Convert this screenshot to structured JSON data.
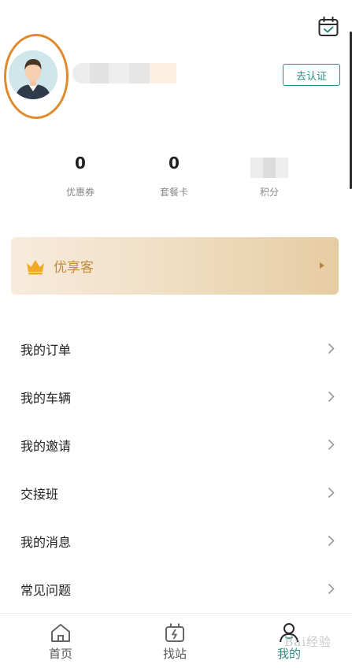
{
  "header": {
    "calendar_icon": "calendar-check-icon"
  },
  "profile": {
    "verify_label": "去认证"
  },
  "stats": {
    "coupons": {
      "value": "0",
      "label": "优惠券"
    },
    "packages": {
      "value": "0",
      "label": "套餐卡"
    },
    "points": {
      "label": "积分"
    }
  },
  "vip": {
    "title": "优享客"
  },
  "menu": {
    "items": [
      {
        "label": "我的订单"
      },
      {
        "label": "我的车辆"
      },
      {
        "label": "我的邀请"
      },
      {
        "label": "交接班"
      },
      {
        "label": "我的消息"
      },
      {
        "label": "常见问题"
      }
    ]
  },
  "tabbar": {
    "home_label": "首页",
    "station_label": "找站",
    "mine_label": "我的"
  },
  "watermark": {
    "text": "Bai经验"
  },
  "colors": {
    "accent": "#2f8b84",
    "avatar_ring": "#e08a2e",
    "vip_text": "#c08a3e"
  }
}
